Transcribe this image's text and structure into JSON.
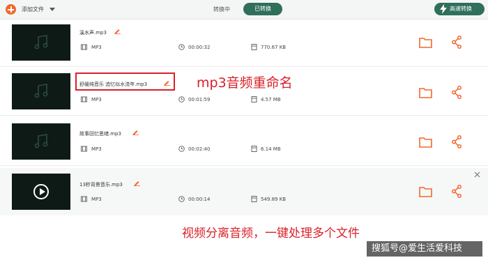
{
  "toolbar": {
    "add_file_label": "添加文件",
    "tab_converting": "转换中",
    "tab_converted": "已转换",
    "fast_convert_label": "高速转换"
  },
  "files": [
    {
      "name": "溪水声.mp3",
      "format": "MP3",
      "duration": "00:00:32",
      "size": "770.67 KB",
      "thumbnail": "music-note-icon"
    },
    {
      "name": "舒缓纯音乐 追忆似水流年.mp3",
      "format": "MP3",
      "duration": "00:01:59",
      "size": "4.57 MB",
      "thumbnail": "music-note-icon"
    },
    {
      "name": "故事回忆思绪.mp3",
      "format": "MP3",
      "duration": "00:02:40",
      "size": "6.14 MB",
      "thumbnail": "music-note-icon"
    },
    {
      "name": "13秒背景音乐.mp3",
      "format": "MP3",
      "duration": "00:00:14",
      "size": "549.89 KB",
      "thumbnail": "play-icon"
    }
  ],
  "annotations": {
    "callout": "mp3音频重命名",
    "caption": "视频分离音频，一键处理多个文件",
    "watermark": "搜狐号@爱生活爱科技"
  },
  "colors": {
    "accent_orange": "#f0682c",
    "accent_green": "#2f6f5b",
    "annotation_red": "#d8202a"
  }
}
